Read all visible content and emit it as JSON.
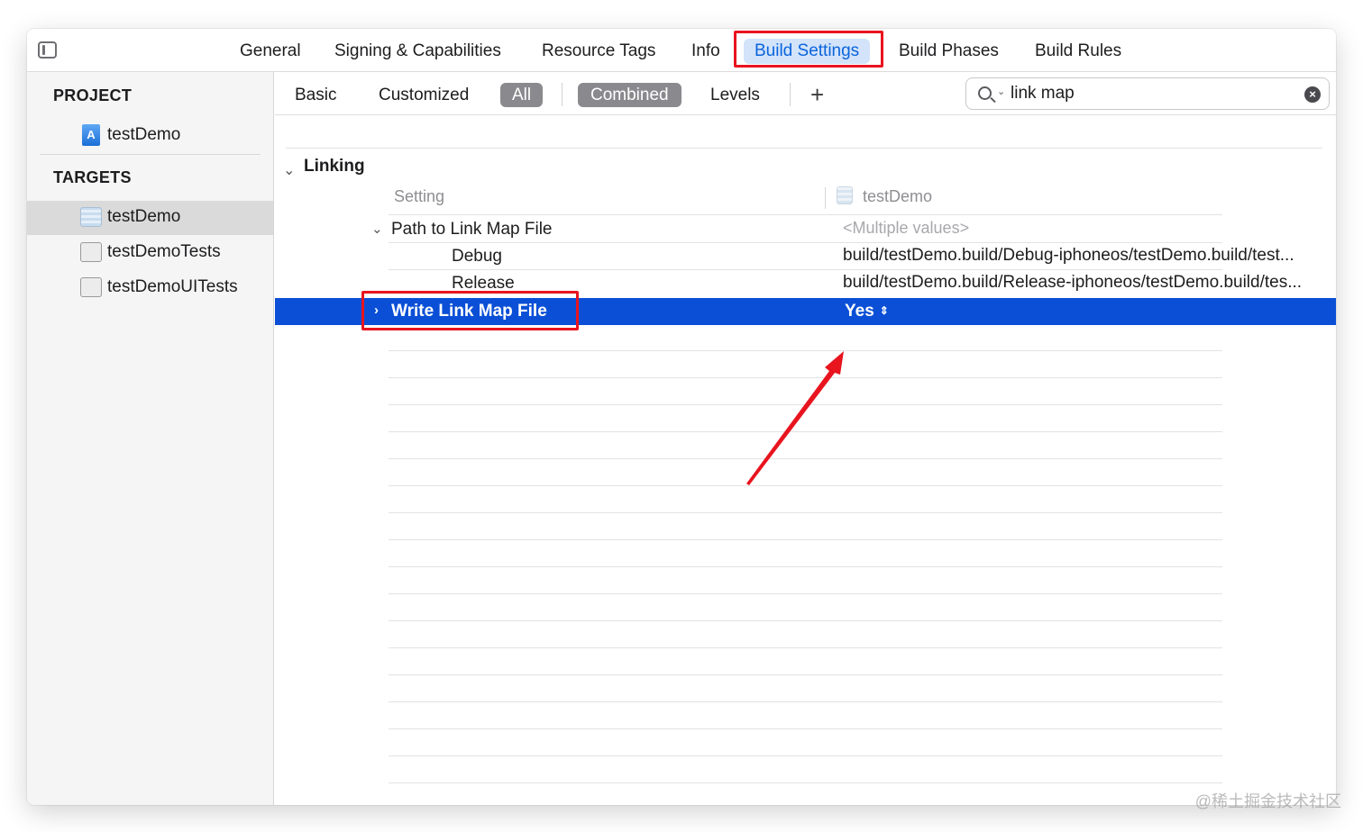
{
  "topbar": {
    "tabs": [
      {
        "label": "General"
      },
      {
        "label": "Signing & Capabilities"
      },
      {
        "label": "Resource Tags"
      },
      {
        "label": "Info"
      },
      {
        "label": "Build Settings"
      },
      {
        "label": "Build Phases"
      },
      {
        "label": "Build Rules"
      }
    ],
    "selected_tab": "Build Settings"
  },
  "sidebar": {
    "project_header": "PROJECT",
    "project_item": "testDemo",
    "targets_header": "TARGETS",
    "targets": [
      {
        "label": "testDemo",
        "selected": true
      },
      {
        "label": "testDemoTests",
        "selected": false
      },
      {
        "label": "testDemoUITests",
        "selected": false
      }
    ]
  },
  "filterbar": {
    "basic": "Basic",
    "customized": "Customized",
    "all": "All",
    "combined": "Combined",
    "levels": "Levels",
    "add": "+",
    "search_value": "link map"
  },
  "settings": {
    "group_title": "Linking",
    "column_setting": "Setting",
    "column_target": "testDemo",
    "rows": [
      {
        "name": "Path to Link Map File",
        "value": "<Multiple values>"
      },
      {
        "name": "Debug",
        "value": "build/testDemo.build/Debug-iphoneos/testDemo.build/test..."
      },
      {
        "name": "Release",
        "value": "build/testDemo.build/Release-iphoneos/testDemo.build/tes..."
      },
      {
        "name": "Write Link Map File",
        "value": "Yes"
      }
    ]
  },
  "watermark": "@稀土掘金技术社区",
  "colors": {
    "selection": "#0a4fd6",
    "selected_tab_text": "#0a64dc",
    "highlight_box": "#e8141e",
    "arrow": "#e8141e"
  }
}
